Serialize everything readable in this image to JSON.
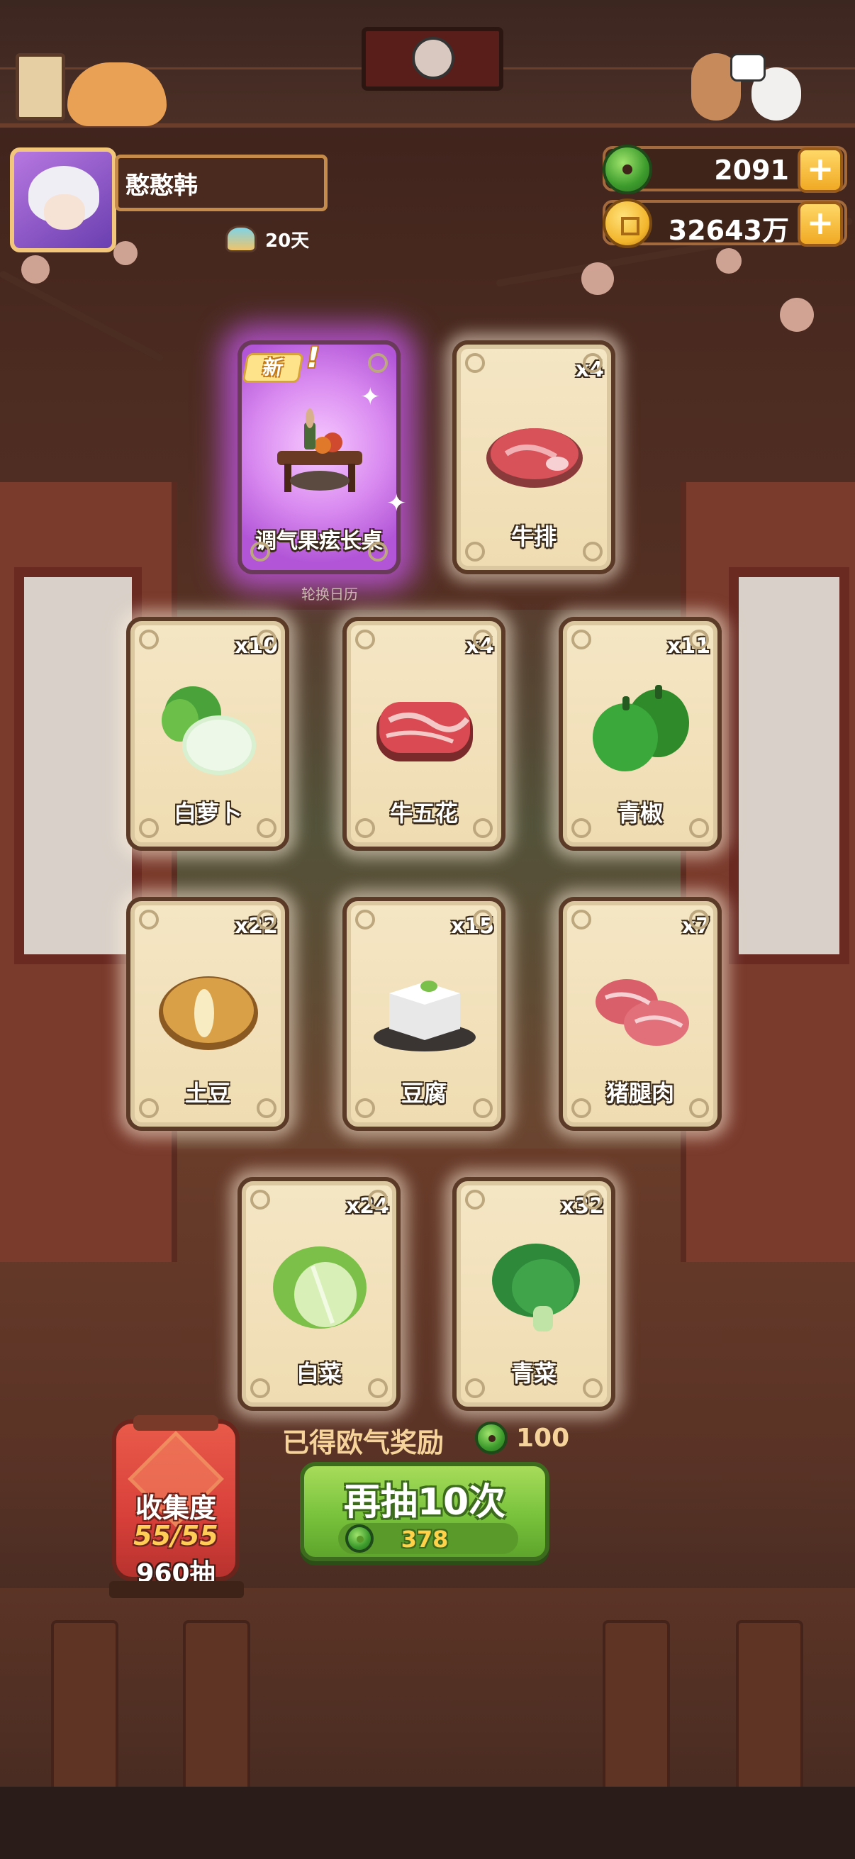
{
  "player": {
    "name": "憨憨韩",
    "days": "20天"
  },
  "currencies": {
    "jade": {
      "value": "2091",
      "icon": "jade-coin-icon"
    },
    "gold": {
      "value": "32643万",
      "icon": "gold-coin-icon"
    },
    "plus_label": "+"
  },
  "featured": {
    "new_badge": "新",
    "new_mark": "!",
    "card": {
      "name": "调气果痃长桌",
      "rarity_color": "#c56ae6"
    },
    "sublabel": "轮换日历"
  },
  "cards": [
    {
      "name": "牛排",
      "count": "x4",
      "icon": "steak-icon"
    },
    {
      "name": "白萝卜",
      "count": "x10",
      "icon": "radish-icon"
    },
    {
      "name": "牛五花",
      "count": "x4",
      "icon": "beef-belly-icon"
    },
    {
      "name": "青椒",
      "count": "x11",
      "icon": "green-pepper-icon"
    },
    {
      "name": "土豆",
      "count": "x22",
      "icon": "potato-icon"
    },
    {
      "name": "豆腐",
      "count": "x15",
      "icon": "tofu-icon"
    },
    {
      "name": "猪腿肉",
      "count": "x7",
      "icon": "pork-leg-icon"
    },
    {
      "name": "白菜",
      "count": "x24",
      "icon": "cabbage-icon"
    },
    {
      "name": "青菜",
      "count": "x32",
      "icon": "bok-choy-icon"
    }
  ],
  "reward": {
    "label": "已得欧气奖励",
    "value": "100"
  },
  "draw_button": {
    "label": "再抽10次",
    "cost": "378",
    "color": "#78c23c"
  },
  "collection": {
    "title": "收集度",
    "progress": "55/55",
    "draws": "960抽"
  }
}
